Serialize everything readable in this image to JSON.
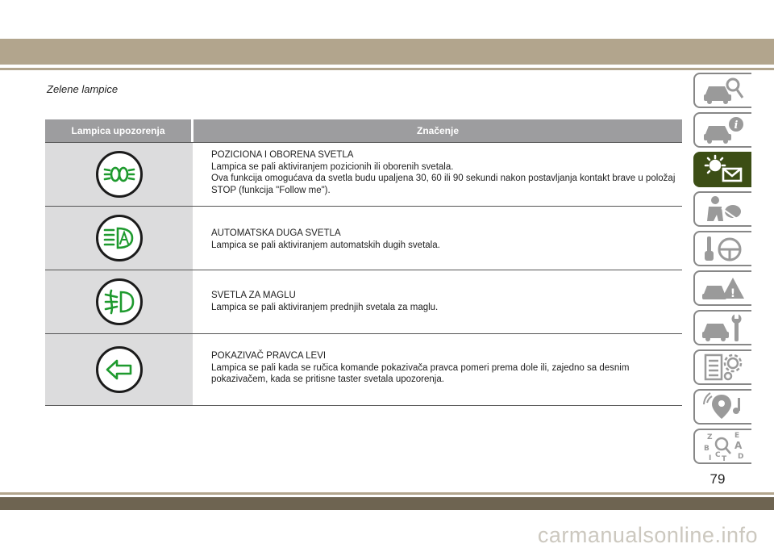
{
  "section_title": "Zelene lampice",
  "table": {
    "header_col1": "Lampica upozorenja",
    "header_col2": "Značenje",
    "rows": [
      {
        "icon": "headlights-icon",
        "title": "POZICIONA I OBORENA SVETLA",
        "lines": [
          "Lampica se pali aktiviranjem pozicionih ili oborenih svetala.",
          "Ova funkcija omogućava da svetla budu upaljena 30, 60 ili 90 sekundi nakon postavljanja kontakt brave u položaj STOP (funkcija \"Follow me\")."
        ]
      },
      {
        "icon": "auto-high-beam-icon",
        "title": "AUTOMATSKA DUGA SVETLA",
        "lines": [
          "Lampica se pali aktiviranjem automatskih dugih svetala."
        ]
      },
      {
        "icon": "fog-light-icon",
        "title": "SVETLA ZA MAGLU",
        "lines": [
          "Lampica se pali aktiviranjem prednjih svetala za maglu."
        ]
      },
      {
        "icon": "left-turn-arrow-icon",
        "title": "POKAZIVAČ PRAVCA LEVI",
        "lines": [
          "Lampica se pali kada se ručica komande pokazivača pravca pomeri prema dole ili, zajedno sa desnim pokazivačem, kada se pritisne taster svetala upozorenja."
        ]
      }
    ]
  },
  "colors": {
    "icon_green": "#1e9a2e",
    "active_tab": "#3c4e15",
    "band": "#b2a58d"
  },
  "side_tabs": [
    "car-search-icon",
    "car-info-icon",
    "warning-lights-icon",
    "airbag-person-icon",
    "steering-wheel-icon",
    "car-breakdown-icon",
    "car-service-icon",
    "specs-gear-icon",
    "multimedia-icon",
    "index-letters-icon"
  ],
  "index_letters": [
    "Z",
    "E",
    "B",
    "A",
    "I",
    "C",
    "T",
    "D"
  ],
  "page_number": "79",
  "watermark": "carmanualsonline.info"
}
